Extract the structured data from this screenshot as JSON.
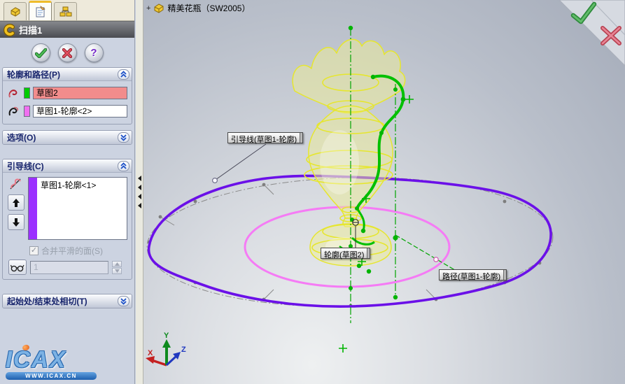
{
  "panel": {
    "title": "扫描1",
    "tabs": {
      "feature_manager_icon": "part-icon",
      "property_manager_icon": "property-sheet-icon",
      "configuration_manager_icon": "configuration-icon"
    },
    "actions": {
      "ok_glyph": "✔",
      "cancel_glyph": "✖",
      "help_glyph": "?"
    },
    "sections": {
      "profile_path": {
        "label": "轮廓和路径(P)",
        "collapsed": false,
        "profile": {
          "value": "草图2",
          "swatch_color": "#00cc00",
          "field_bg": "#f28c8c"
        },
        "path": {
          "value": "草图1-轮廓<2>",
          "swatch_color": "#f070f0",
          "field_bg": "#ffffff"
        }
      },
      "options": {
        "label": "选项(O)",
        "collapsed": true
      },
      "guide_curves": {
        "label": "引导线(C)",
        "collapsed": false,
        "items": [
          {
            "value": "草图1-轮廓<1>",
            "swatch_color": "#9b30ff"
          }
        ],
        "merge_checkbox_label": "合并平滑的面(S)",
        "merge_checkbox_checked": true,
        "spin_value": "1"
      },
      "tangency": {
        "label": "起始处/结束处相切(T)",
        "collapsed": true
      }
    },
    "watermark": {
      "logo": "ICAX",
      "url": "WWW.ICAX.CN"
    }
  },
  "viewport": {
    "tree_node": {
      "expand": "+",
      "label": "精美花瓶（SW2005）"
    },
    "callouts": {
      "guide": "引导线(草图1-轮廓)",
      "profile": "轮廓(草图2)",
      "path": "路径(草图1-轮廓)"
    },
    "triad": {
      "x": "X",
      "y": "Y",
      "z": "Z"
    },
    "colors": {
      "selected_sketch_green": "#00b400",
      "sweep_profile_purple": "#6b10e8",
      "path_ellipse_pink": "#f57bf5",
      "model_yellow": "#e6e62e",
      "construction_gray": "#8a8a8a",
      "highlight_field_red": "#f28c8c"
    }
  }
}
